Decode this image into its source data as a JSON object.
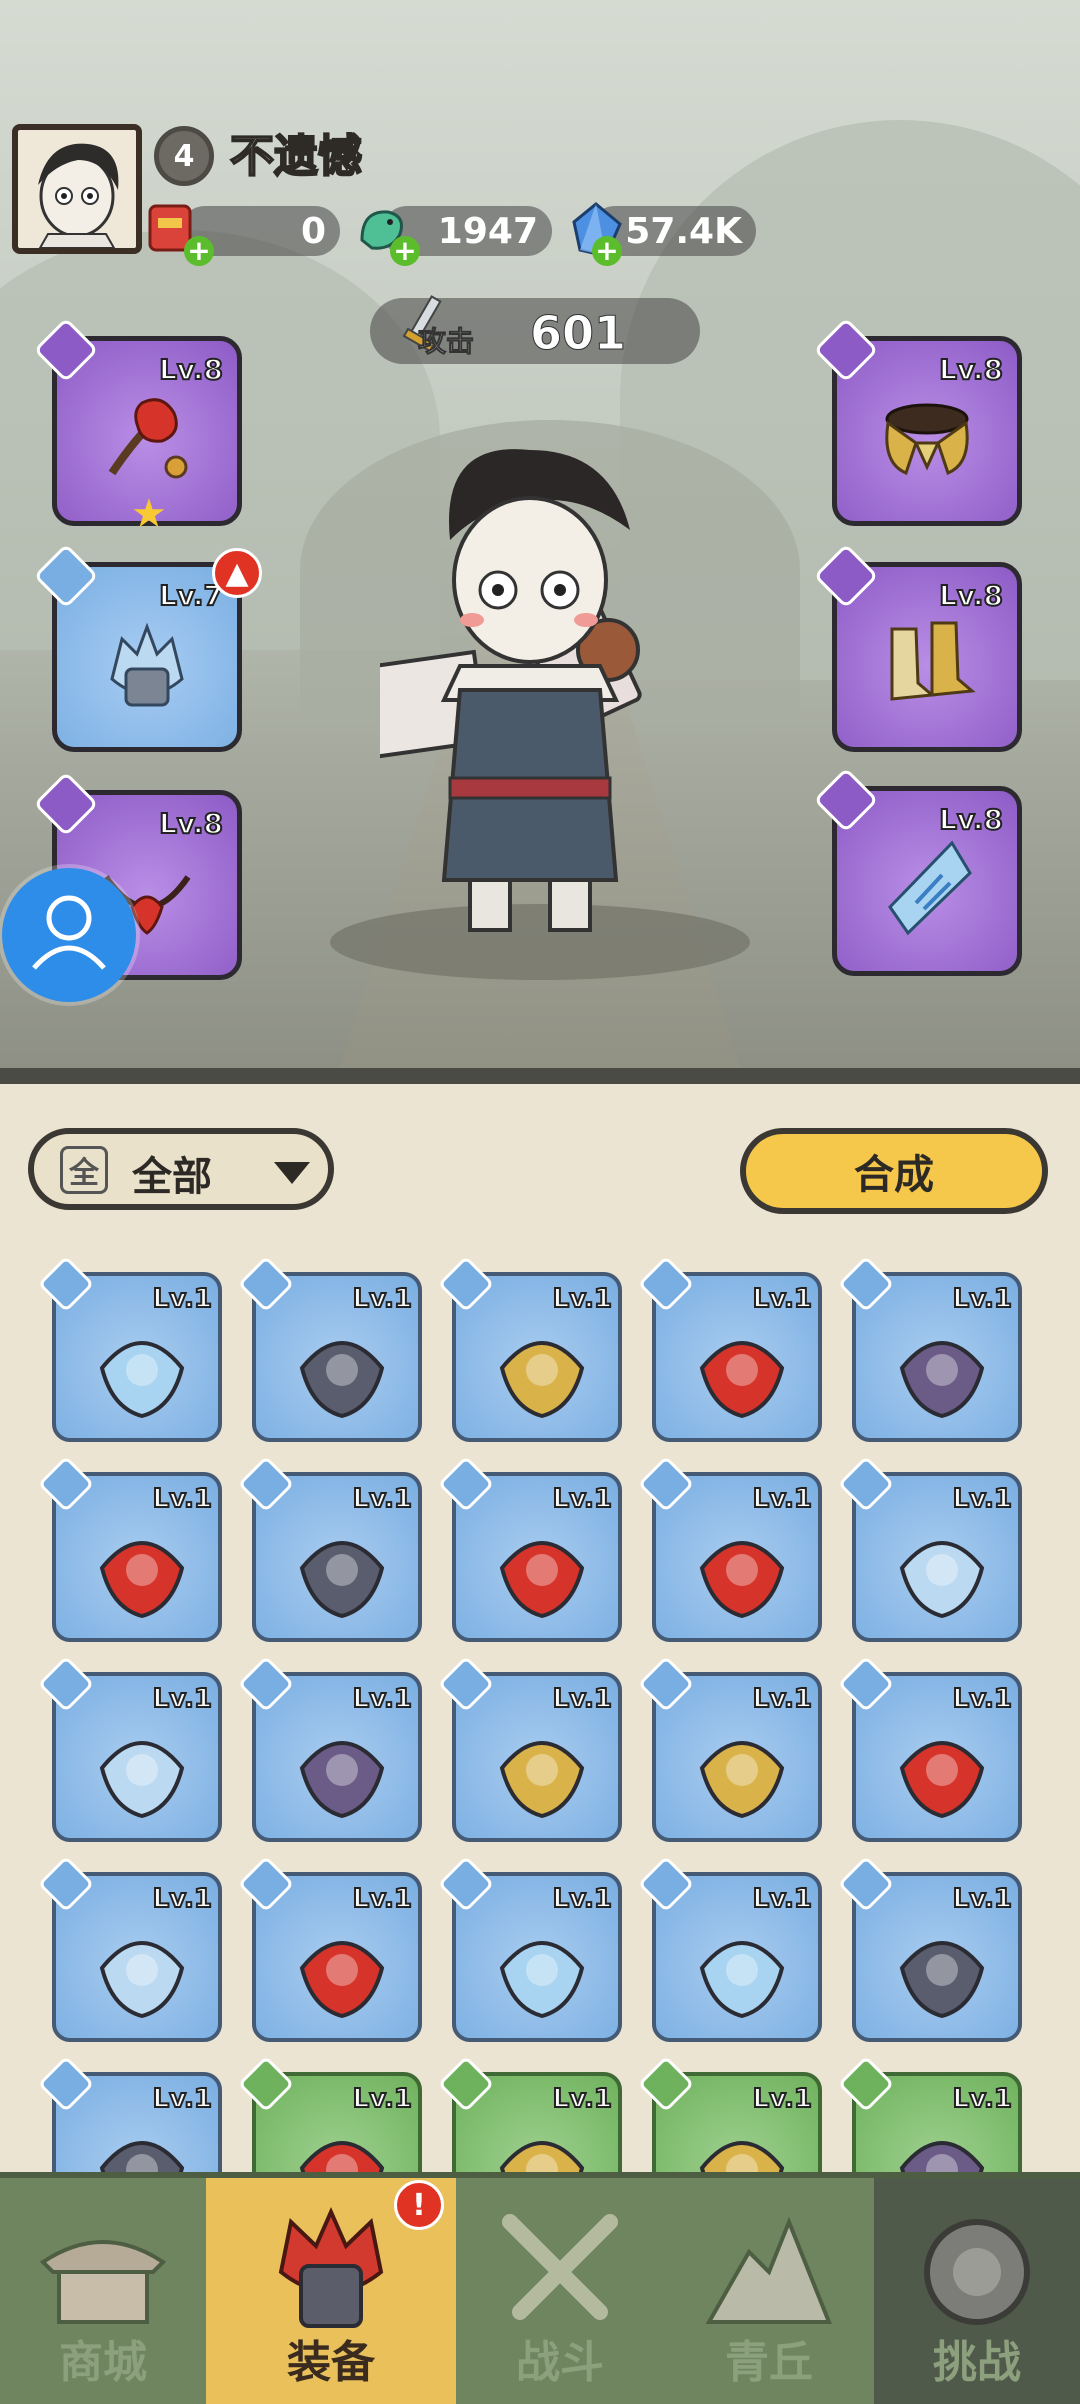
{
  "player": {
    "level": "4",
    "name": "不遗憾"
  },
  "resources": [
    {
      "name": "red-packet",
      "value": "0"
    },
    {
      "name": "jade-dragon",
      "value": "1947"
    },
    {
      "name": "blue-crystal",
      "value": "57.4K"
    }
  ],
  "attack": {
    "label": "攻击",
    "value": "601"
  },
  "equipped": {
    "left": [
      {
        "level": "Lv.8",
        "tier": "purple",
        "item": "red-flower-whip",
        "starred": true
      },
      {
        "level": "Lv.7",
        "tier": "blue",
        "item": "ice-helmet",
        "upgrade": true
      },
      {
        "level": "Lv.8",
        "tier": "purple",
        "item": "flame-necklace"
      }
    ],
    "right": [
      {
        "level": "Lv.8",
        "tier": "purple",
        "item": "gold-shoulder-armor"
      },
      {
        "level": "Lv.8",
        "tier": "purple",
        "item": "gold-boots"
      },
      {
        "level": "Lv.8",
        "tier": "purple",
        "item": "blue-jade-pendant"
      }
    ]
  },
  "filter": {
    "icon_char": "全",
    "label": "全部"
  },
  "combine_label": "合成",
  "inventory": [
    {
      "level": "Lv.1",
      "tier": "blue",
      "item": "crossbow"
    },
    {
      "level": "Lv.1",
      "tier": "blue",
      "item": "hammer"
    },
    {
      "level": "Lv.1",
      "tier": "blue",
      "item": "gold-staff"
    },
    {
      "level": "Lv.1",
      "tier": "blue",
      "item": "red-helmet"
    },
    {
      "level": "Lv.1",
      "tier": "blue",
      "item": "purple-helmet"
    },
    {
      "level": "Lv.1",
      "tier": "blue",
      "item": "red-necklace"
    },
    {
      "level": "Lv.1",
      "tier": "blue",
      "item": "dark-necklace"
    },
    {
      "level": "Lv.1",
      "tier": "blue",
      "item": "red-shoulder-armor"
    },
    {
      "level": "Lv.1",
      "tier": "blue",
      "item": "red-shoulder-armor"
    },
    {
      "level": "Lv.1",
      "tier": "blue",
      "item": "frost-shoulder-armor"
    },
    {
      "level": "Lv.1",
      "tier": "blue",
      "item": "frost-shoulder-armor"
    },
    {
      "level": "Lv.1",
      "tier": "blue",
      "item": "purple-shoulder-armor"
    },
    {
      "level": "Lv.1",
      "tier": "blue",
      "item": "gold-shoulder-armor"
    },
    {
      "level": "Lv.1",
      "tier": "blue",
      "item": "gold-shoulder-armor"
    },
    {
      "level": "Lv.1",
      "tier": "blue",
      "item": "red-boots"
    },
    {
      "level": "Lv.1",
      "tier": "blue",
      "item": "frost-boots"
    },
    {
      "level": "Lv.1",
      "tier": "blue",
      "item": "fire-orb-pendant"
    },
    {
      "level": "Lv.1",
      "tier": "blue",
      "item": "blue-jade-pendant"
    },
    {
      "level": "Lv.1",
      "tier": "blue",
      "item": "blue-jade-pendant"
    },
    {
      "level": "Lv.1",
      "tier": "blue",
      "item": "dark-orb-pendant"
    },
    {
      "level": "Lv.1",
      "tier": "blue",
      "item": "dark-orb-pendant"
    },
    {
      "level": "Lv.1",
      "tier": "green",
      "item": "red-flower-whip"
    },
    {
      "level": "Lv.1",
      "tier": "green",
      "item": "gold-staff"
    },
    {
      "level": "Lv.1",
      "tier": "green",
      "item": "gold-staff"
    },
    {
      "level": "Lv.1",
      "tier": "green",
      "item": "purple-helmet"
    }
  ],
  "nav": [
    {
      "label": "商城",
      "icon": "shop-icon",
      "state": "normal"
    },
    {
      "label": "装备",
      "icon": "equipment-icon",
      "state": "active",
      "alert": "!"
    },
    {
      "label": "战斗",
      "icon": "battle-icon",
      "state": "normal"
    },
    {
      "label": "青丘",
      "icon": "qingqiu-icon",
      "state": "normal"
    },
    {
      "label": "挑战",
      "icon": "challenge-icon",
      "state": "disabled"
    }
  ],
  "colors": {
    "purple_tier": "#8d5bc6",
    "blue_tier": "#79aee2",
    "green_tier": "#6fb25d",
    "gold_button": "#f5c74a",
    "nav_bg": "#6f8560"
  }
}
